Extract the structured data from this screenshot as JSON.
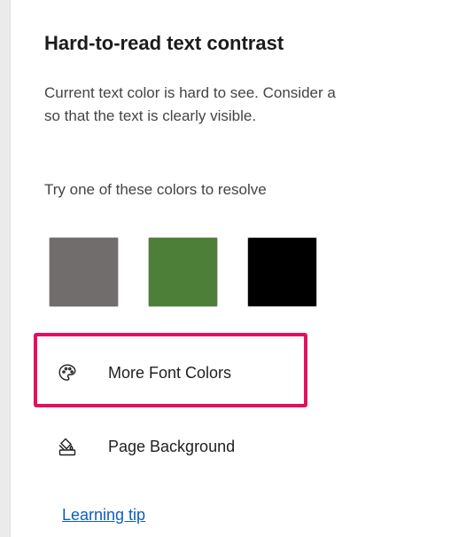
{
  "panel": {
    "title": "Hard-to-read text contrast",
    "description_line1": "Current text color is hard to see. Consider a",
    "description_line2": "so that the text is clearly visible.",
    "suggestion_label": "Try one of these colors to resolve"
  },
  "swatches": [
    {
      "color": "#716d6c"
    },
    {
      "color": "#4e7f39"
    },
    {
      "color": "#000000"
    }
  ],
  "actions": {
    "more_font_colors": {
      "label": "More Font Colors",
      "icon": "palette-icon"
    },
    "page_background": {
      "label": "Page Background",
      "icon": "paint-bucket-icon"
    }
  },
  "learning_tip": {
    "label": "Learning tip"
  },
  "colors": {
    "highlight": "#e3105f",
    "link": "#0f5cc2"
  }
}
